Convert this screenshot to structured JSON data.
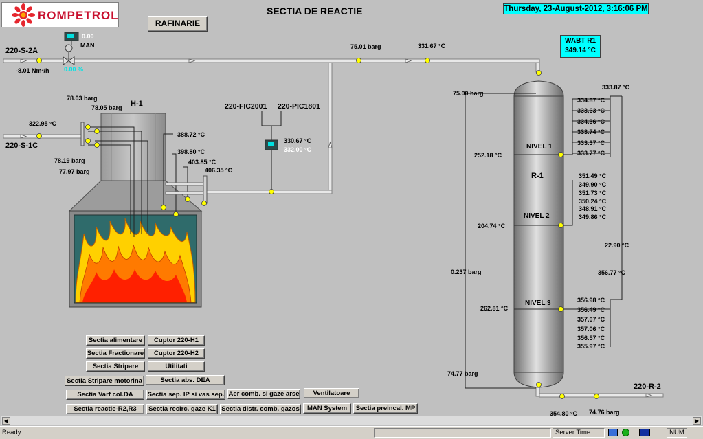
{
  "header": {
    "logo_text": "ROMPETROL",
    "title": "SECTIA DE REACTIE",
    "datetime": "Thursday, 23-August-2012, 3:16:06 PM",
    "rafinarie_button": "RAFINARIE"
  },
  "wabt": {
    "title": "WABT R1",
    "value": "349.14 °C"
  },
  "feed": {
    "tag_s2a": "220-S-2A",
    "flow": "-8.01 Nm³/h",
    "valve_value": "0.00",
    "valve_mode": "MAN",
    "valve_output": "0.00 %",
    "line_pressure": "75.01 barg",
    "line_temp": "331.67 °C"
  },
  "furnace": {
    "tag": "H-1",
    "inlet_tag": "220-S-1C",
    "inlet_temp": "322.95 °C",
    "p1": "78.03 barg",
    "p2": "78.05 barg",
    "p3": "78.19 barg",
    "p4": "77.97 barg",
    "t1": "388.72 °C",
    "t2": "398.80 °C",
    "t3": "403.85 °C",
    "t4": "406.35 °C"
  },
  "controller": {
    "fic_tag": "220-FIC2001",
    "pic_tag": "220-PIC1801",
    "pv": "330.67 °C",
    "sp": "332.00 °C"
  },
  "reactor": {
    "tag": "R-1",
    "outlet_tag": "220-R-2",
    "top_pressure": "75.00 barg",
    "top_temp": "333.87 °C",
    "dp": "0.237 barg",
    "bottom_pressure": "74.77 barg",
    "bed_dt": "22.90 °C",
    "mid_temp": "356.77 °C",
    "outlet_temp": "354.80 °C",
    "outlet_pressure": "74.76 barg",
    "nivel1": {
      "label": "NIVEL 1",
      "left_temp": "252.18 °C",
      "temps": [
        "334.87 °C",
        "333.63 °C",
        "334.36 °C",
        "333.74 °C",
        "333.37 °C",
        "333.77 °C"
      ]
    },
    "nivel2": {
      "label": "NIVEL 2",
      "left_temp": "204.74 °C",
      "temps": [
        "351.49 °C",
        "349.90 °C",
        "351.73 °C",
        "350.24 °C",
        "348.91 °C",
        "349.86 °C"
      ]
    },
    "nivel3": {
      "label": "NIVEL 3",
      "left_temp": "262.81 °C",
      "temps": [
        "356.98 °C",
        "356.49 °C",
        "357.07 °C",
        "357.06 °C",
        "356.57 °C",
        "355.97 °C"
      ]
    }
  },
  "nav": {
    "buttons": [
      "Sectia alimentare",
      "Cuptor 220-H1",
      "Sectia Fractionare",
      "Cuptor 220-H2",
      "Sectia Stripare",
      "Utilitati",
      "Sectia Stripare motorina",
      "Sectia abs. DEA",
      "Sectia Varf col.DA",
      "Sectia sep. IP si vas sep.",
      "Aer comb. si gaze arse",
      "Ventilatoare",
      "Sectia reactie-R2,R3",
      "Sectia recirc. gaze  K1",
      "Sectia distr. comb. gazos",
      "MAN System",
      "Sectia preincal. MP"
    ]
  },
  "statusbar": {
    "left": "Ready",
    "server_time": "Server Time",
    "num": "NUM"
  },
  "colors": {
    "background": "#c0c0c0",
    "cyan": "#00ffff",
    "vessel": "#a8a8a8",
    "furnace_box": "#2f6b6b",
    "flame_outer": "#ffd000",
    "flame_inner": "#ff2000",
    "sensor_dot": "#ffff00"
  }
}
